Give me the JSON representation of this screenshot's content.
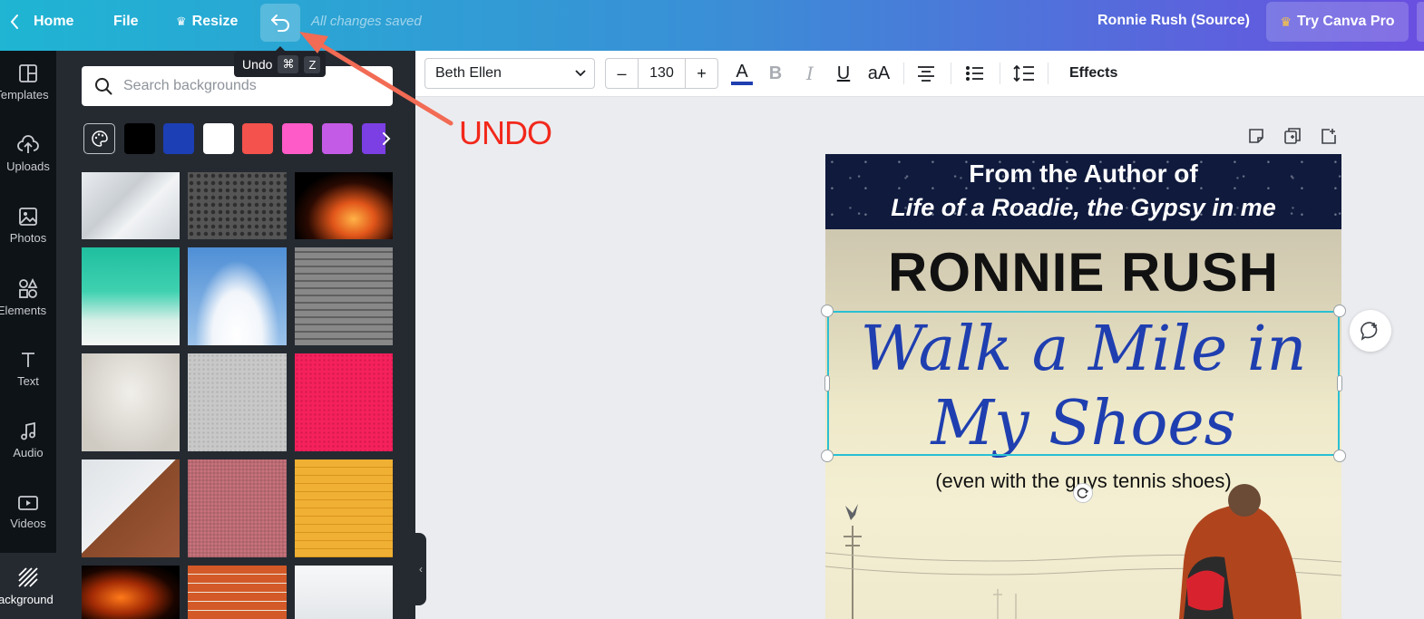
{
  "topbar": {
    "home": "Home",
    "file": "File",
    "resize": "Resize",
    "save_status": "All changes saved",
    "project_title": "Ronnie Rush (Source)",
    "try_pro": "Try Canva Pro"
  },
  "tooltip": {
    "label": "Undo",
    "key1": "⌘",
    "key2": "Z"
  },
  "rail": {
    "items": [
      {
        "label": "Templates",
        "icon": "templates-icon"
      },
      {
        "label": "Uploads",
        "icon": "upload-cloud-icon"
      },
      {
        "label": "Photos",
        "icon": "photo-icon"
      },
      {
        "label": "Elements",
        "icon": "shapes-icon"
      },
      {
        "label": "Text",
        "icon": "text-icon"
      },
      {
        "label": "Audio",
        "icon": "music-note-icon"
      },
      {
        "label": "Videos",
        "icon": "video-icon"
      },
      {
        "label": "Background",
        "icon": "background-stripes-icon"
      }
    ]
  },
  "panel": {
    "search_placeholder": "Search backgrounds",
    "swatches": [
      "#000000",
      "#1c3fb5",
      "#ffffff",
      "#f4524c",
      "#ff5bc8",
      "#c45be6",
      "#7b3fe4"
    ]
  },
  "toolbar": {
    "font": "Beth Ellen",
    "size_minus": "–",
    "size": "130",
    "size_plus": "+",
    "text_color_glyph": "A",
    "text_color": "#1f3fb0",
    "bold": "B",
    "italic": "I",
    "underline": "U",
    "case": "aA",
    "effects": "Effects"
  },
  "annotation": {
    "label": "UNDO"
  },
  "cover": {
    "line1": "From the Author of",
    "line2": "Life of a Roadie, the Gypsy in me",
    "author": "RONNIE RUSH",
    "title_line1": "Walk a Mile in",
    "title_line2": "My Shoes",
    "subtitle": "(even with the guys tennis shoes)"
  }
}
